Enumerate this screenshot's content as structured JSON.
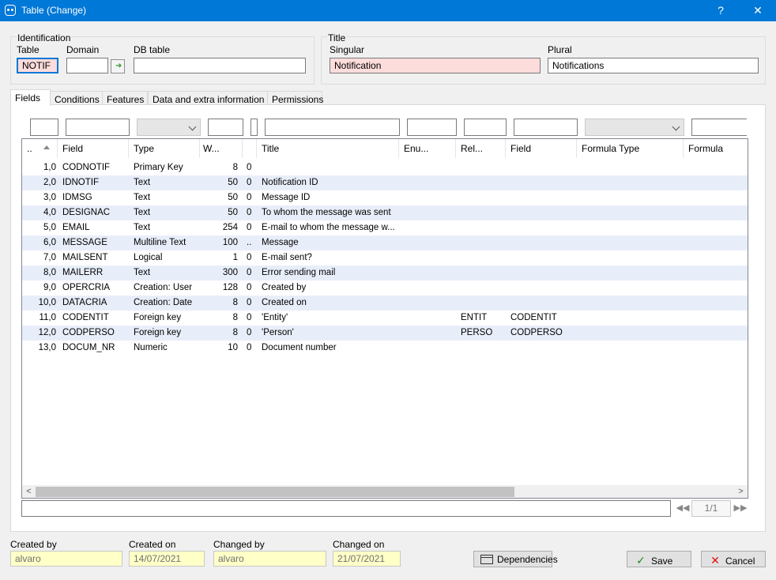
{
  "window": {
    "title": "Table (Change)",
    "help": "?",
    "close": "✕"
  },
  "identification": {
    "legend": "Identification",
    "table_label": "Table",
    "table_value": "NOTIF",
    "domain_label": "Domain",
    "domain_value": "",
    "dbtable_label": "DB table",
    "dbtable_value": ""
  },
  "title_group": {
    "legend": "Title",
    "singular_label": "Singular",
    "singular_value": "Notification",
    "plural_label": "Plural",
    "plural_value": "Notifications"
  },
  "tabs": [
    "Fields",
    "Conditions",
    "Features",
    "Data and extra information",
    "Permissions"
  ],
  "grid": {
    "columns": [
      "..",
      "Field",
      "Type",
      "W...",
      "",
      "Title",
      "Enu...",
      "Rel...",
      "Field",
      "Formula Type",
      "Formula"
    ],
    "rows": [
      [
        "1,0",
        "CODNOTIF",
        "Primary Key",
        "8",
        "0",
        "",
        "",
        "",
        ""
      ],
      [
        "2,0",
        "IDNOTIF",
        "Text",
        "50",
        "0",
        "Notification ID",
        "",
        "",
        ""
      ],
      [
        "3,0",
        "IDMSG",
        "Text",
        "50",
        "0",
        "Message ID",
        "",
        "",
        ""
      ],
      [
        "4,0",
        "DESIGNAC",
        "Text",
        "50",
        "0",
        "To whom the message was sent",
        "",
        "",
        ""
      ],
      [
        "5,0",
        "EMAIL",
        "Text",
        "254",
        "0",
        "E-mail to whom the message w...",
        "",
        "",
        ""
      ],
      [
        "6,0",
        "MESSAGE",
        "Multiline Text",
        "100",
        "..",
        "Message",
        "",
        "",
        ""
      ],
      [
        "7,0",
        "MAILSENT",
        "Logical",
        "1",
        "0",
        "E-mail sent?",
        "",
        "",
        ""
      ],
      [
        "8,0",
        "MAILERR",
        "Text",
        "300",
        "0",
        "Error sending mail",
        "",
        "",
        ""
      ],
      [
        "9,0",
        "OPERCRIA",
        "Creation: User",
        "128",
        "0",
        "Created by",
        "",
        "",
        ""
      ],
      [
        "10,0",
        "DATACRIA",
        "Creation: Date",
        "8",
        "0",
        "Created on",
        "",
        "",
        ""
      ],
      [
        "11,0",
        "CODENTIT",
        "Foreign key",
        "8",
        "0",
        "'Entity'",
        "",
        "ENTIT",
        "CODENTIT"
      ],
      [
        "12,0",
        "CODPERSO",
        "Foreign key",
        "8",
        "0",
        "'Person'",
        "",
        "PERSO",
        "CODPERSO"
      ],
      [
        "13,0",
        "DOCUM_NR",
        "Numeric",
        "10",
        "0",
        "Document number",
        "",
        "",
        ""
      ]
    ]
  },
  "pager": {
    "first": "◀◀",
    "last": "▶▶",
    "page": "1/1"
  },
  "footer": {
    "created_by_label": "Created by",
    "created_by_value": "alvaro",
    "created_on_label": "Created on",
    "created_on_value": "14/07/2021",
    "changed_by_label": "Changed by",
    "changed_by_value": "alvaro",
    "changed_on_label": "Changed on",
    "changed_on_value": "21/07/2021",
    "dependencies_label": "Dependencies",
    "save_label": "Save",
    "cancel_label": "Cancel"
  },
  "colors": {
    "titlebar": "#0078d7",
    "required_field": "#fddcdc",
    "readonly_field": "#ffffc8",
    "alt_row": "#e8eef9"
  }
}
